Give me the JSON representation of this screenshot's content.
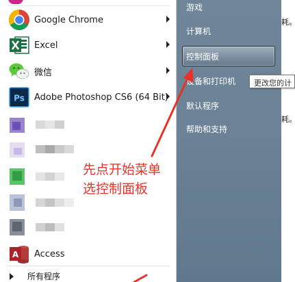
{
  "programs": [
    {
      "label": "Google Chrome",
      "icon": "chrome-icon",
      "has_submenu": true
    },
    {
      "label": "Excel",
      "icon": "excel-icon",
      "has_submenu": true
    },
    {
      "label": "微信",
      "icon": "wechat-icon",
      "has_submenu": true
    },
    {
      "label": "Adobe Photoshop CS6 (64 Bit)",
      "icon": "photoshop-icon",
      "has_submenu": true
    },
    {
      "label": "Access",
      "icon": "access-icon",
      "has_submenu": false
    }
  ],
  "all_programs_label": "所有程序",
  "right_menu": {
    "items": [
      "游戏",
      "计算机",
      "控制面板",
      "设备和打印机",
      "默认程序",
      "帮助和支持"
    ],
    "highlighted": "控制面板"
  },
  "tooltip": "更改您的计",
  "desktop_fragments": [
    "耗。",
    "耗。"
  ],
  "annotation": {
    "line1": "先点开始菜单",
    "line2": "选控制面板",
    "color": "#e8332a"
  }
}
